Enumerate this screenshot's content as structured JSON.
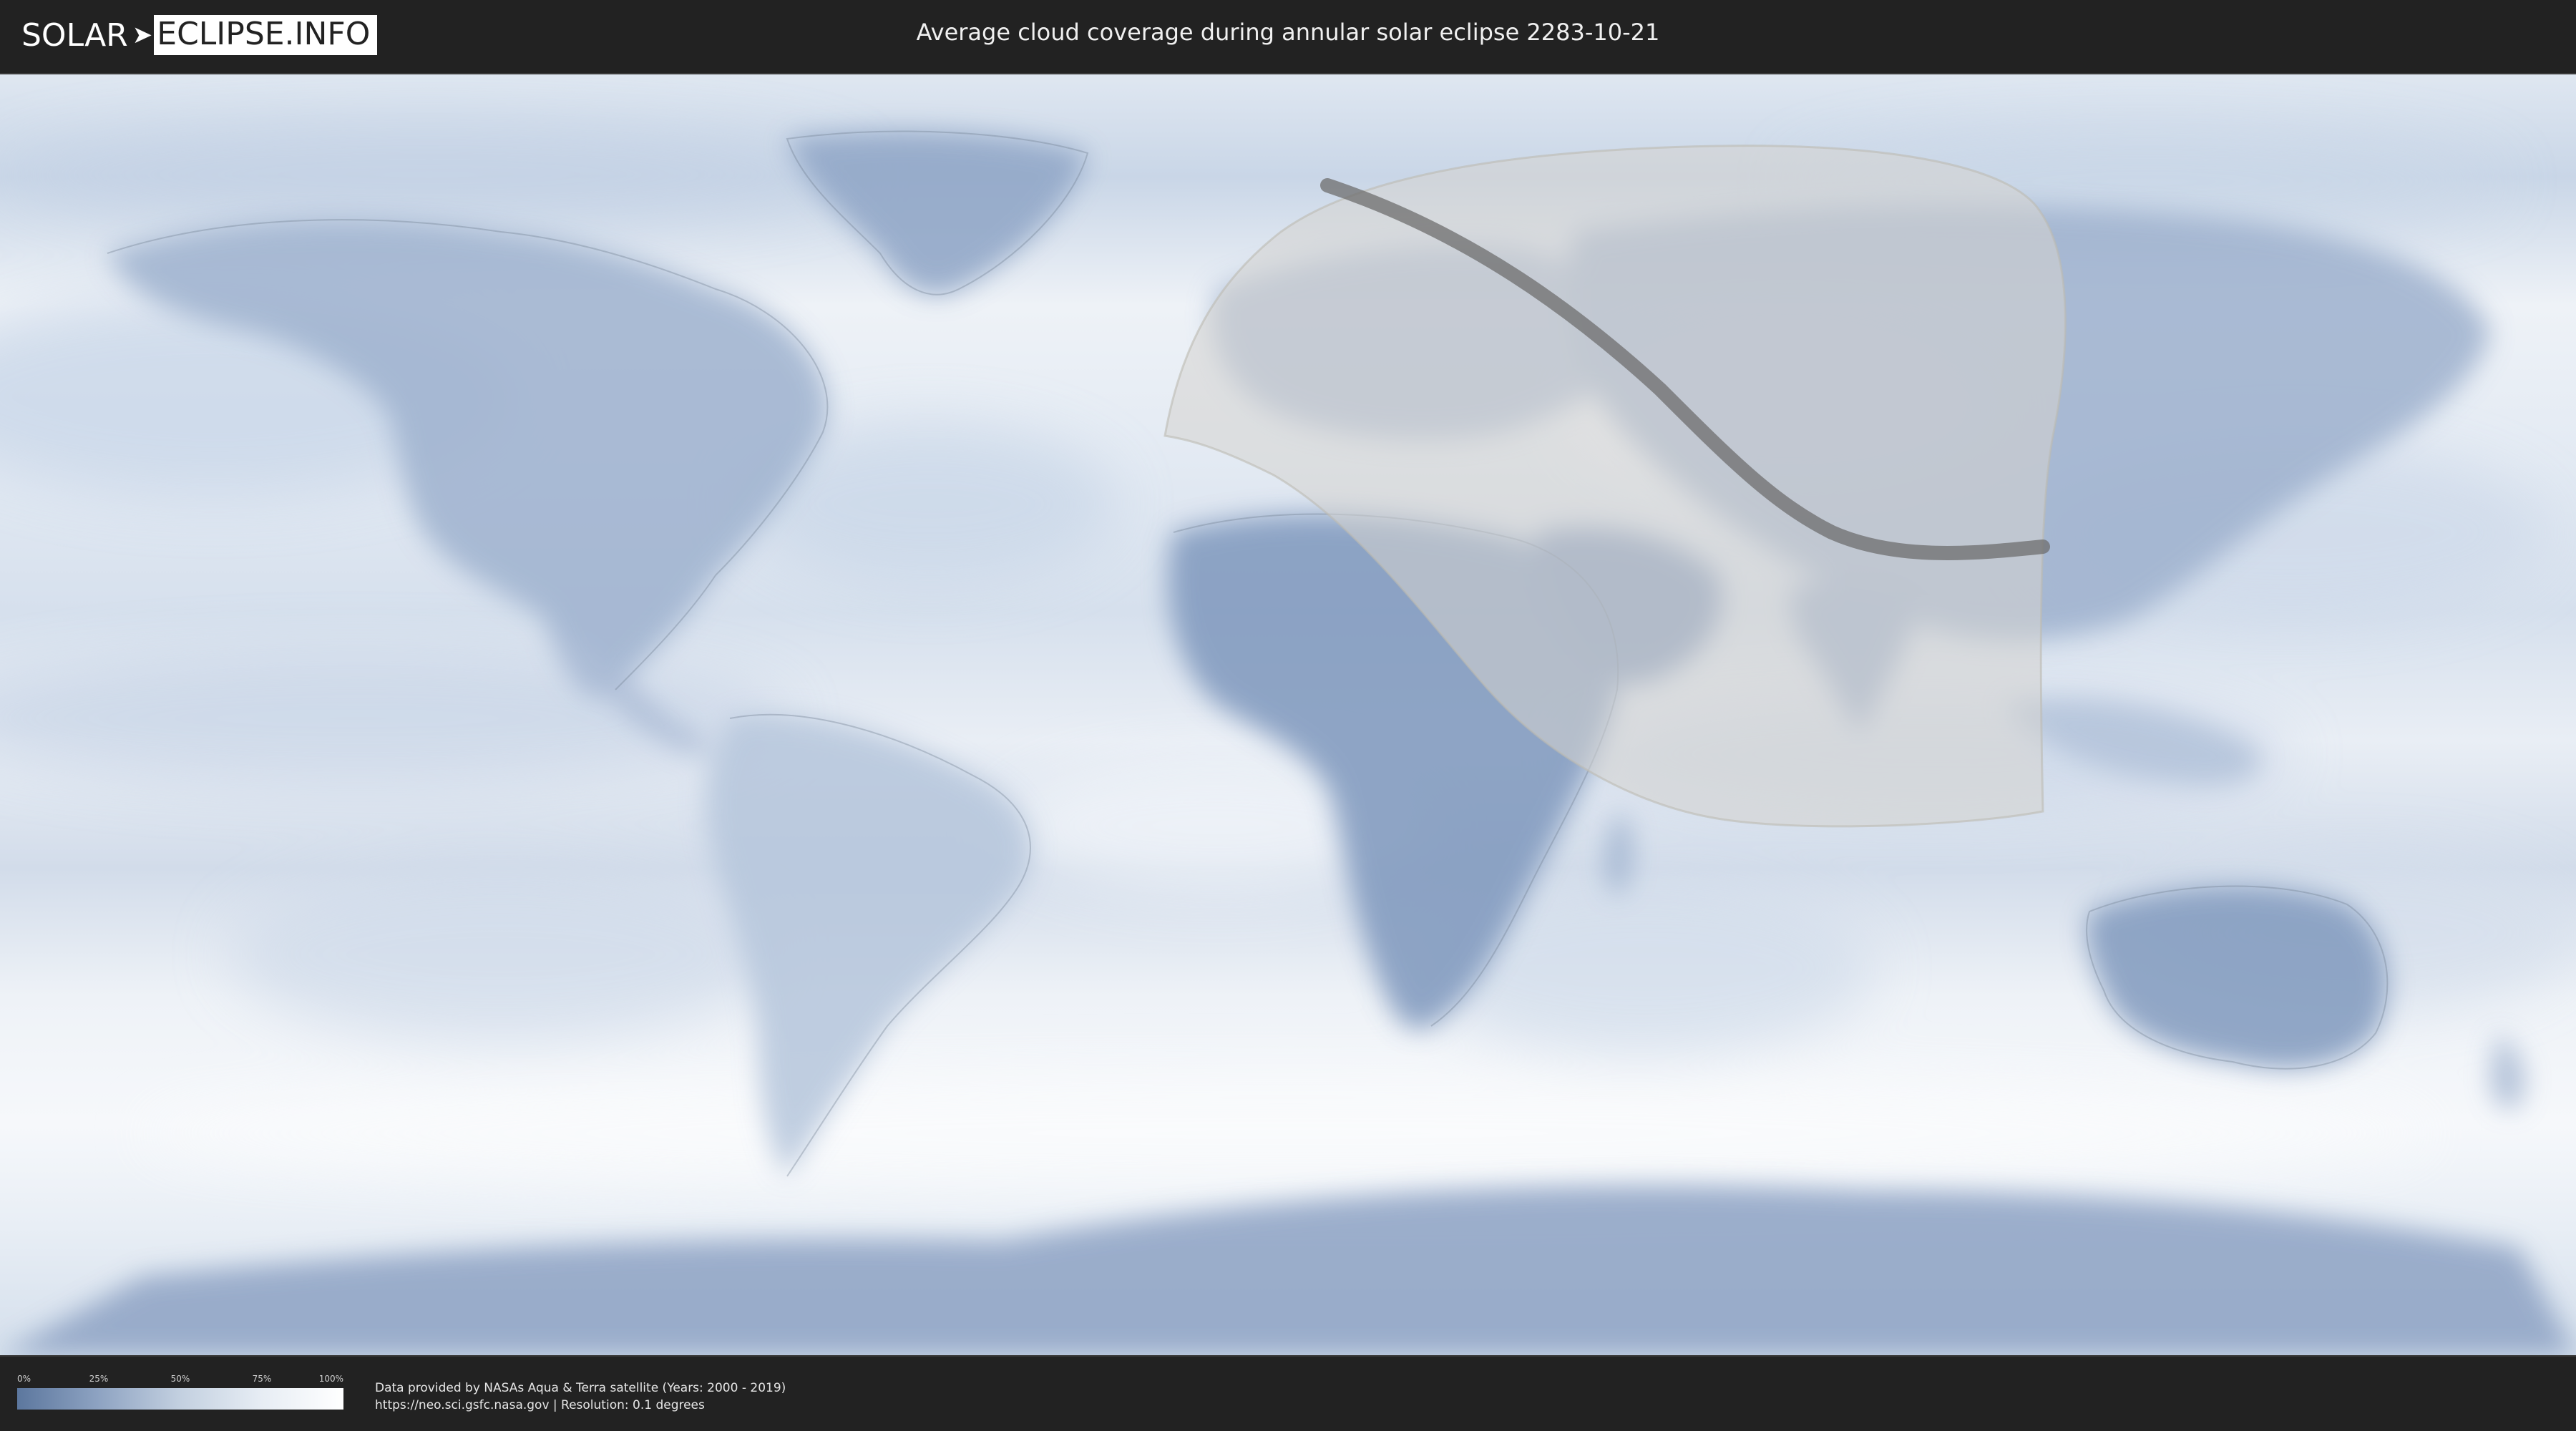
{
  "header": {
    "logo_left": "SOLAR",
    "logo_right": "ECLIPSE.INFO",
    "title": "Average cloud coverage during annular solar eclipse 2283-10-21"
  },
  "legend": {
    "ticks": [
      "0%",
      "25%",
      "50%",
      "75%",
      "100%"
    ],
    "colors": [
      "#5c779e",
      "#8ea3c2",
      "#c3d0e0",
      "#e7edf4",
      "#ffffff"
    ]
  },
  "credits": {
    "line1": "Data provided by NASAs Aqua & Terra satellite (Years: 2000 - 2019)",
    "line2": "https://neo.sci.gsfc.nasa.gov | Resolution: 0.1 degrees"
  },
  "map": {
    "projection": "equirectangular",
    "eclipse_type": "annular",
    "colors": {
      "ocean_cloud": "#e9eef5",
      "land_clear": "#7f98bd",
      "penumbra": "#d8d6d2",
      "path": "#6d6d6d"
    }
  }
}
